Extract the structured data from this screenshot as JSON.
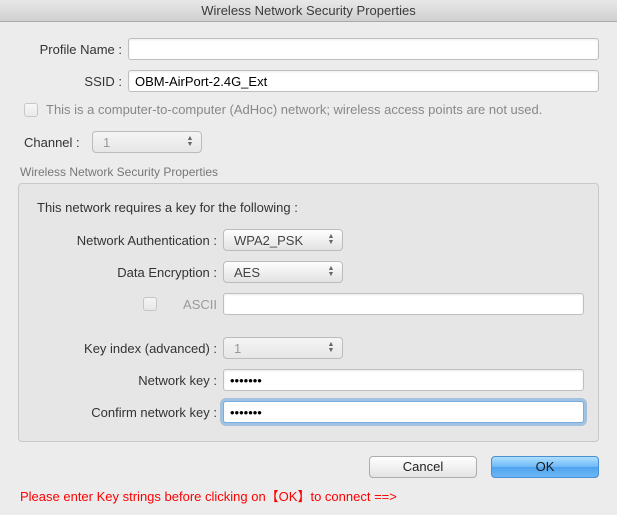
{
  "window": {
    "title": "Wireless Network Security Properties"
  },
  "form": {
    "profile_name_label": "Profile Name :",
    "profile_name_value": "",
    "ssid_label": "SSID :",
    "ssid_value": "OBM-AirPort-2.4G_Ext",
    "adhoc_text": "This is a computer-to-computer (AdHoc) network; wireless access points are not used.",
    "channel_label": "Channel :",
    "channel_value": "1"
  },
  "group": {
    "legend": "Wireless Network Security Properties",
    "intro": "This network requires a key for the following :",
    "auth_label": "Network Authentication :",
    "auth_value": "WPA2_PSK",
    "enc_label": "Data Encryption :",
    "enc_value": "AES",
    "ascii_label": "ASCII",
    "ascii_value": "",
    "key_index_label": "Key index (advanced) :",
    "key_index_value": "1",
    "net_key_label": "Network key :",
    "net_key_value": "•••••••",
    "confirm_key_label": "Confirm network key :",
    "confirm_key_value": "•••••••"
  },
  "buttons": {
    "cancel": "Cancel",
    "ok": "OK"
  },
  "footer": "Please enter Key strings before clicking on【OK】to connect ==>"
}
